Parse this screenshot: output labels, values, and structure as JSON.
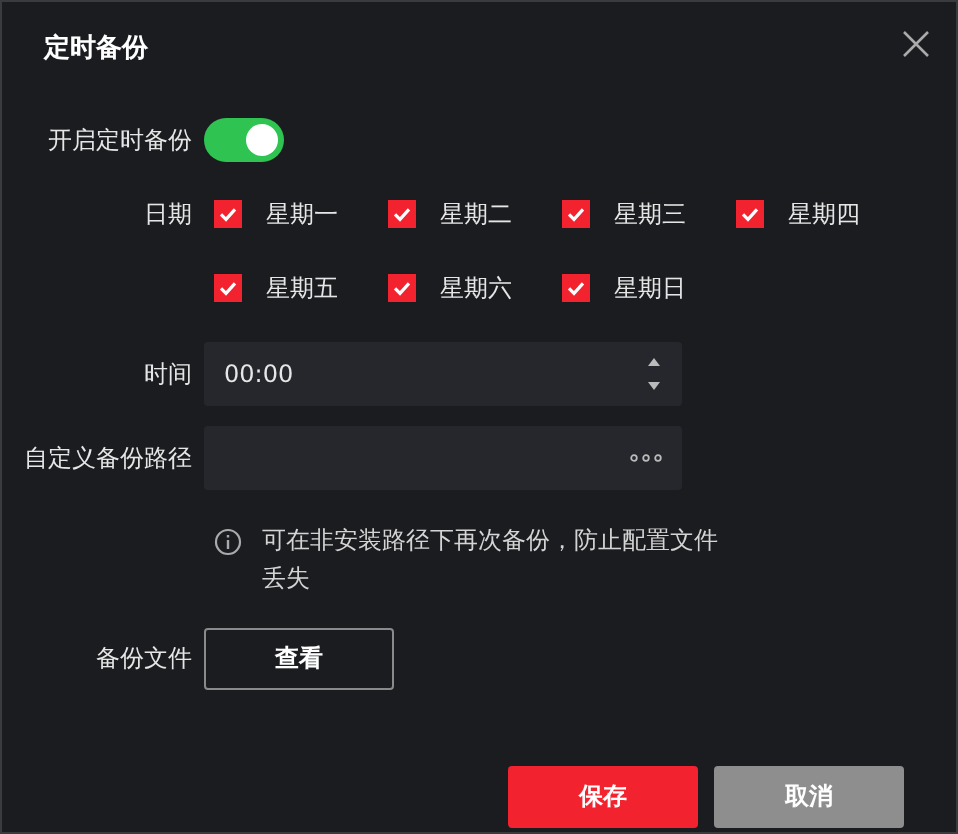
{
  "dialog": {
    "title": "定时备份"
  },
  "enable": {
    "label": "开启定时备份",
    "on": true
  },
  "days": {
    "label": "日期",
    "items": [
      {
        "label": "星期一",
        "checked": true
      },
      {
        "label": "星期二",
        "checked": true
      },
      {
        "label": "星期三",
        "checked": true
      },
      {
        "label": "星期四",
        "checked": true
      },
      {
        "label": "星期五",
        "checked": true
      },
      {
        "label": "星期六",
        "checked": true
      },
      {
        "label": "星期日",
        "checked": true
      }
    ]
  },
  "time": {
    "label": "时间",
    "value": "00:00"
  },
  "path": {
    "label": "自定义备份路径"
  },
  "hint": "可在非安装路径下再次备份，防止配置文件丢失",
  "backup_file": {
    "label": "备份文件",
    "button": "查看"
  },
  "buttons": [
    {
      "label": "保存",
      "kind": "primary"
    },
    {
      "label": "取消",
      "kind": "secondary"
    }
  ]
}
